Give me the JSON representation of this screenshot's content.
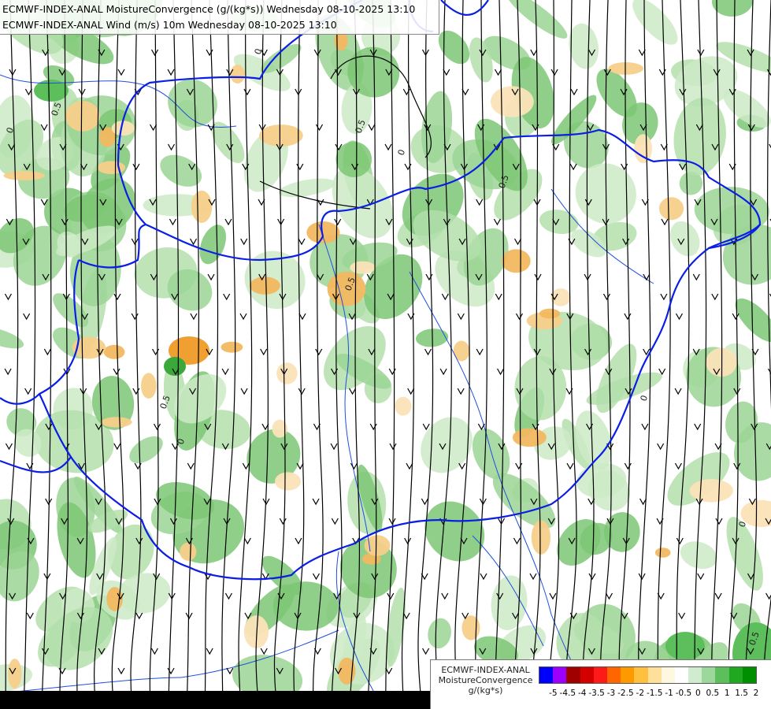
{
  "title_lines": [
    "ECMWF-INDEX-ANAL MoistureConvergence (g/(kg*s)) Wednesday 08-10-2025 13:10",
    "ECMWF-INDEX-ANAL Wind (m/s) 10m Wednesday 08-10-2025 13:10"
  ],
  "legend": {
    "title_lines": [
      "ECMWF-INDEX-ANAL",
      "MoistureConvergence",
      "g/(kg*s)"
    ],
    "colors": [
      "#0000ff",
      "#9b00ff",
      "#a00000",
      "#d40000",
      "#ff1a1a",
      "#ff6600",
      "#ff9900",
      "#ffc040",
      "#ffe09a",
      "#fff8e0",
      "#ffffff",
      "#cfeccf",
      "#9cd89c",
      "#5cbf5c",
      "#21a821",
      "#008f00"
    ],
    "ticks": [
      "-5",
      "-4.5",
      "-4",
      "-3.5",
      "-3",
      "-2.5",
      "-2",
      "-1.5",
      "-1",
      "-0.5",
      "0",
      "0.5",
      "1",
      "1.5",
      "2"
    ]
  },
  "contour_labels": [
    "0",
    "0.5"
  ],
  "colors": {
    "border": "#0a1ee6",
    "river": "#1f4fe0",
    "streamline": "#000000",
    "convergence_green": "#b8e2b0",
    "divergence_orange": "#f2b860"
  },
  "map_features": {
    "streamlines": "wind-streamlines",
    "borders": "country-borders",
    "rivers": "rivers"
  }
}
